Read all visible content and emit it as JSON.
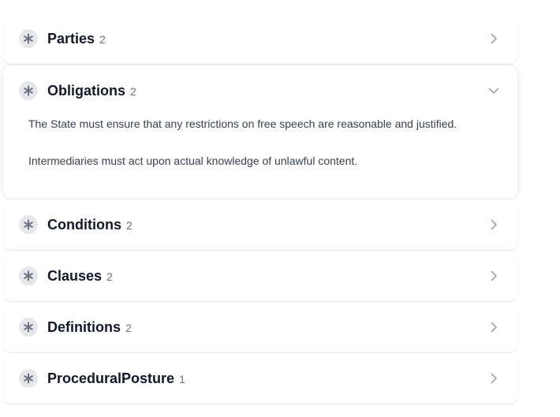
{
  "sections": [
    {
      "title": "Parties",
      "count": "2",
      "expanded": false
    },
    {
      "title": "Obligations",
      "count": "2",
      "expanded": true,
      "items": [
        "The State must ensure that any restrictions on free speech are reasonable and justified.",
        "Intermediaries must act upon actual knowledge of unlawful content."
      ]
    },
    {
      "title": "Conditions",
      "count": "2",
      "expanded": false
    },
    {
      "title": "Clauses",
      "count": "2",
      "expanded": false
    },
    {
      "title": "Definitions",
      "count": "2",
      "expanded": false
    },
    {
      "title": "ProceduralPosture",
      "count": "1",
      "expanded": false
    }
  ],
  "icons": {
    "section_badge": "asterisk-icon",
    "collapsed_indicator": "chevron-right-icon",
    "expanded_indicator": "chevron-down-icon"
  },
  "colors": {
    "badge_background": "#e5e7eb",
    "badge_icon": "#6b7280",
    "title_text": "#111827",
    "count_text": "#6b7280",
    "body_text": "#374151",
    "chevron": "#9ca3af"
  }
}
